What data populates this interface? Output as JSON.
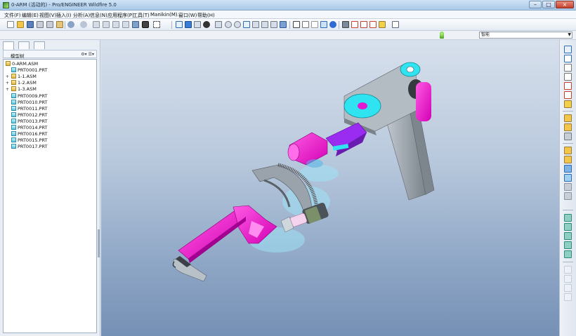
{
  "window": {
    "title": "0-ARM (活动的) - Pro/ENGINEER Wildfire 5.0",
    "minimize": "–",
    "maximize": "□",
    "close": "×"
  },
  "menu": [
    "文件(F)",
    "编辑(E)",
    "视图(V)",
    "插入(I)",
    "分析(A)",
    "信息(N)",
    "应用程序(P)",
    "工具(T)",
    "Manikin(M)...",
    "窗口(W)",
    "帮助(H)"
  ],
  "filter": {
    "selected": "智能"
  },
  "model_tree": {
    "header": "模型树",
    "tools": "⚙▾  ☰▾",
    "items": [
      {
        "label": "0-ARM.ASM",
        "type": "asm",
        "level": 0,
        "expander": ""
      },
      {
        "label": "PRT0001.PRT",
        "type": "prt",
        "level": 1,
        "expander": ""
      },
      {
        "label": "1-1.ASM",
        "type": "asm",
        "level": 1,
        "expander": "+"
      },
      {
        "label": "1-2.ASM",
        "type": "asm",
        "level": 1,
        "expander": "+"
      },
      {
        "label": "1-3.ASM",
        "type": "asm",
        "level": 1,
        "expander": "+"
      },
      {
        "label": "PRT0009.PRT",
        "type": "prt",
        "level": 1,
        "expander": ""
      },
      {
        "label": "PRT0010.PRT",
        "type": "prt",
        "level": 1,
        "expander": ""
      },
      {
        "label": "PRT0011.PRT",
        "type": "prt",
        "level": 1,
        "expander": ""
      },
      {
        "label": "PRT0012.PRT",
        "type": "prt",
        "level": 1,
        "expander": ""
      },
      {
        "label": "PRT0013.PRT",
        "type": "prt",
        "level": 1,
        "expander": ""
      },
      {
        "label": "PRT0014.PRT",
        "type": "prt",
        "level": 1,
        "expander": ""
      },
      {
        "label": "PRT0016.PRT",
        "type": "prt",
        "level": 1,
        "expander": ""
      },
      {
        "label": "PRT0015.PRT",
        "type": "prt",
        "level": 1,
        "expander": ""
      },
      {
        "label": "PRT0017.PRT",
        "type": "prt",
        "level": 1,
        "expander": ""
      }
    ]
  },
  "colors": {
    "magenta": "#ff1fd7",
    "purple": "#9a2bf0",
    "cyan": "#2fe4f0",
    "gray": "#a9b1b9",
    "darkgray": "#6b737b",
    "ghost": "#9fe3f7"
  }
}
